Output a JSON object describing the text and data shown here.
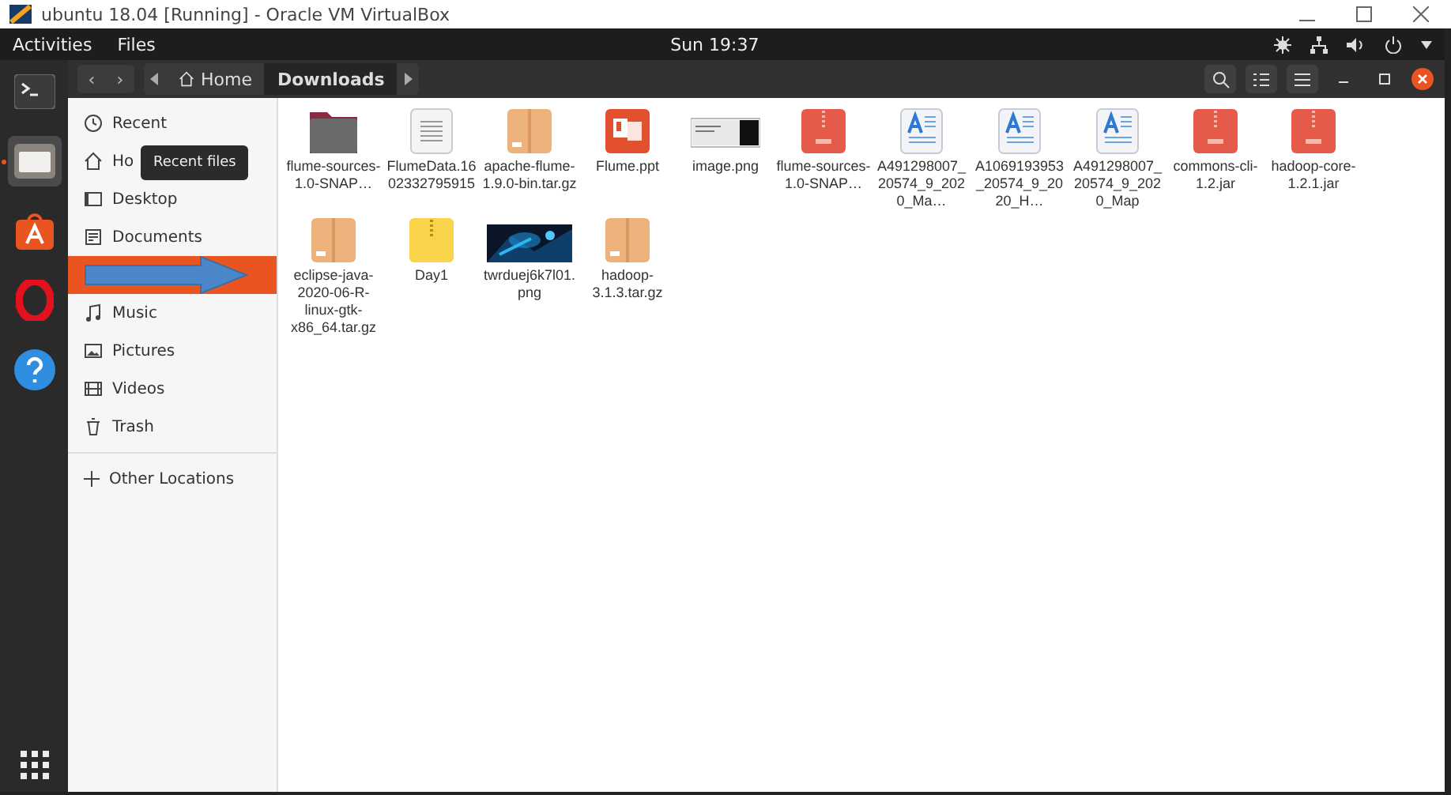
{
  "window": {
    "title": "ubuntu 18.04 [Running] - Oracle VM VirtualBox"
  },
  "topbar": {
    "activities": "Activities",
    "app_menu": "Files",
    "clock": "Sun 19:37"
  },
  "dock": [
    {
      "kind": "terminal",
      "selected": false
    },
    {
      "kind": "files",
      "selected": true
    },
    {
      "kind": "store",
      "selected": false
    },
    {
      "kind": "opera",
      "selected": false
    },
    {
      "kind": "help",
      "selected": false
    }
  ],
  "nav": {
    "back": "‹",
    "forward": "›"
  },
  "path_bar": [
    {
      "label": "Home",
      "kind": "home",
      "selected": false
    },
    {
      "label": "Downloads",
      "kind": "plain",
      "selected": true
    }
  ],
  "sidebar": {
    "items": [
      {
        "label": "Recent",
        "kind": "recent",
        "selected": false
      },
      {
        "label": "Ho",
        "kind": "home",
        "selected": false
      },
      {
        "label": "Desktop",
        "kind": "desktop",
        "selected": false
      },
      {
        "label": "Documents",
        "kind": "documents",
        "selected": false
      },
      {
        "selected": true
      },
      {
        "label": "Music",
        "kind": "music",
        "selected": false
      },
      {
        "label": "Pictures",
        "kind": "pictures",
        "selected": false
      },
      {
        "label": "Videos",
        "kind": "videos",
        "selected": false
      },
      {
        "label": "Trash",
        "kind": "trash",
        "selected": false
      }
    ],
    "other": "Other Locations",
    "tooltip": "Recent files"
  },
  "files": [
    {
      "name": "flume-sources-1.0-SNAP…",
      "kind": "folder"
    },
    {
      "name": "FlumeData.1602332795915",
      "kind": "text"
    },
    {
      "name": "apache-flume-1.9.0-bin.tar.gz",
      "kind": "archive"
    },
    {
      "name": "Flume.ppt",
      "kind": "ppt"
    },
    {
      "name": "image.png",
      "kind": "screenshot"
    },
    {
      "name": "flume-sources-1.0-SNAP…",
      "kind": "jar"
    },
    {
      "name": "A491298007_20574_9_2020_Ma…",
      "kind": "doc"
    },
    {
      "name": "A1069193953_20574_9_2020_H…",
      "kind": "doc"
    },
    {
      "name": "A491298007_20574_9_2020_Map",
      "kind": "doc"
    },
    {
      "name": "commons-cli-1.2.jar",
      "kind": "jar"
    },
    {
      "name": "hadoop-core-1.2.1.jar",
      "kind": "jar"
    },
    {
      "name": "eclipse-java-2020-06-R-linux-gtk-x86_64.tar.gz",
      "kind": "archive"
    },
    {
      "name": "Day1",
      "kind": "zip"
    },
    {
      "name": "twrduej6k7l01.png"
    },
    {
      "name": "hadoop-3.1.3.tar.gz",
      "kind": "archive"
    }
  ]
}
